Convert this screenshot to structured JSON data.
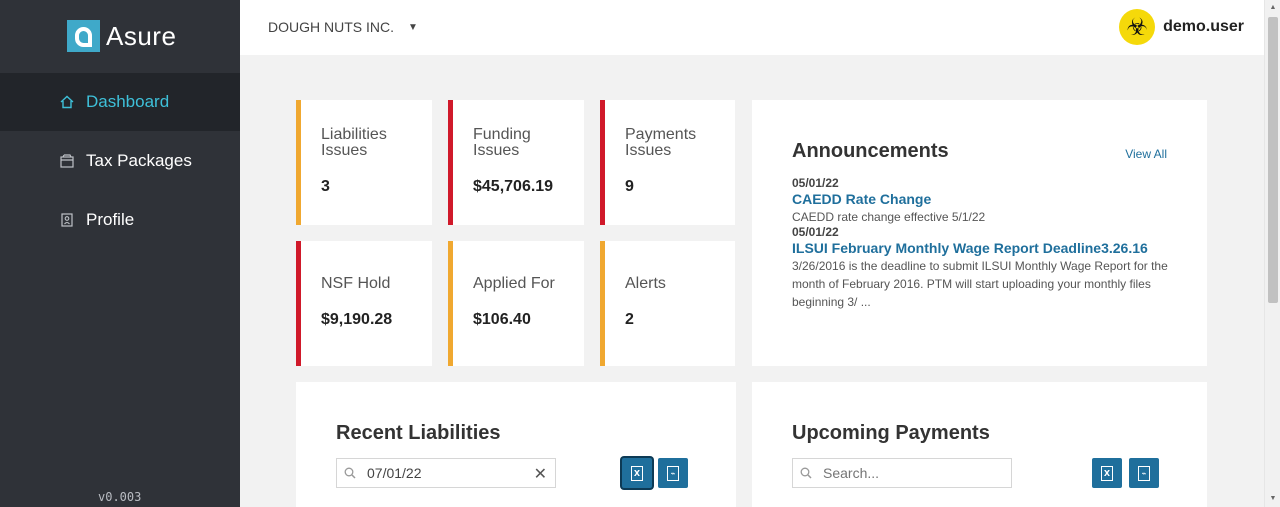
{
  "brand": {
    "name": "Asure"
  },
  "sidebar": {
    "items": [
      {
        "label": "Dashboard",
        "icon": "home-icon",
        "active": true
      },
      {
        "label": "Tax Packages",
        "icon": "package-icon",
        "active": false
      },
      {
        "label": "Profile",
        "icon": "profile-icon",
        "active": false
      }
    ],
    "version": "v0.003"
  },
  "header": {
    "company": "DOUGH NUTS INC.",
    "username": "demo.user",
    "avatar_icon": "biohazard-icon"
  },
  "stats": [
    {
      "label_line1": "Liabilities",
      "label_line2": "Issues",
      "value": "3",
      "status_color": "#f0a830"
    },
    {
      "label_line1": "Funding",
      "label_line2": "Issues",
      "value": "$45,706.19",
      "status_color": "#d0192a"
    },
    {
      "label_line1": "Payments",
      "label_line2": "Issues",
      "value": "9",
      "status_color": "#d0192a"
    },
    {
      "label_line1": "NSF Hold",
      "label_line2": "",
      "value": "$9,190.28",
      "status_color": "#d0192a"
    },
    {
      "label_line1": "Applied For",
      "label_line2": "",
      "value": "$106.40",
      "status_color": "#f0a830"
    },
    {
      "label_line1": "Alerts",
      "label_line2": "",
      "value": "2",
      "status_color": "#f0a830"
    }
  ],
  "announcements": {
    "title": "Announcements",
    "view_all": "View All",
    "items": [
      {
        "date": "05/01/22",
        "title": "CAEDD Rate Change",
        "body": "CAEDD rate change effective 5/1/22"
      },
      {
        "date": "05/01/22",
        "title": "ILSUI February Monthly Wage Report Deadline3.26.16",
        "body": "3/26/2016 is the deadline to submit ILSUI Monthly Wage Report for the month of February 2016. PTM will start uploading your monthly files beginning 3/ ..."
      }
    ]
  },
  "recent_liabilities": {
    "title": "Recent Liabilities",
    "search_value": "07/01/22"
  },
  "upcoming_payments": {
    "title": "Upcoming Payments",
    "search_placeholder": "Search..."
  },
  "colors": {
    "accent": "#1f6f9c",
    "sidebar_bg": "#2f3238",
    "active_nav": "#3ec0d9"
  }
}
